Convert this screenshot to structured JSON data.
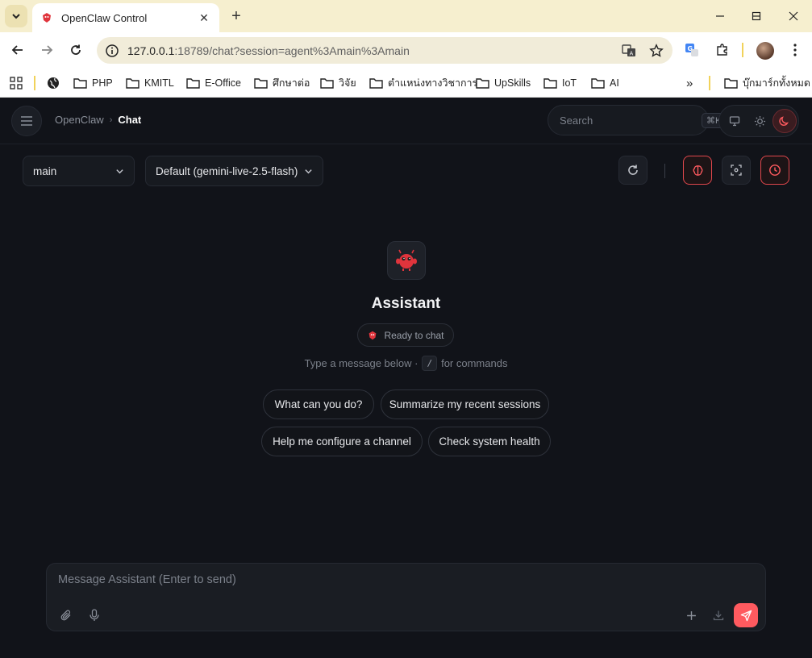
{
  "browser": {
    "tab_title": "OpenClaw Control",
    "url_host": "127.0.0.1",
    "url_rest": ":18789/chat?session=agent%3Amain%3Amain",
    "bookmarks": [
      {
        "label": "",
        "icon": "globe-icon"
      },
      {
        "label": "PHP",
        "icon": "folder-icon"
      },
      {
        "label": "KMITL",
        "icon": "folder-icon"
      },
      {
        "label": "E-Office",
        "icon": "folder-icon"
      },
      {
        "label": "ศึกษาต่อ",
        "icon": "folder-icon"
      },
      {
        "label": "วิจัย",
        "icon": "folder-icon"
      },
      {
        "label": "ตำแหน่งทางวิชาการ",
        "icon": "folder-icon"
      },
      {
        "label": "UpSkills",
        "icon": "folder-icon"
      },
      {
        "label": "IoT",
        "icon": "folder-icon"
      },
      {
        "label": "AI",
        "icon": "folder-icon"
      }
    ],
    "more_bookmarks": "»",
    "all_bookmarks": "บุ๊กมาร์กทั้งหมด"
  },
  "header": {
    "breadcrumb_root": "OpenClaw",
    "breadcrumb_separator": "›",
    "breadcrumb_current": "Chat",
    "search_placeholder": "Search",
    "search_shortcut": "⌘K"
  },
  "controls": {
    "session_select": "main",
    "model_select": "Default (gemini-live-2.5-flash)"
  },
  "welcome": {
    "agent_name": "Assistant",
    "status": "Ready to chat",
    "hint_before": "Type a message below ·",
    "hint_key": "/",
    "hint_after": "for commands",
    "suggestions": [
      "What can you do?",
      "Summarize my recent sessions",
      "Help me configure a channel",
      "Check system health"
    ]
  },
  "composer": {
    "placeholder": "Message Assistant (Enter to send)"
  },
  "colors": {
    "accent": "#ff5a5f",
    "background": "#111319",
    "chrome": "#f6efcf"
  }
}
